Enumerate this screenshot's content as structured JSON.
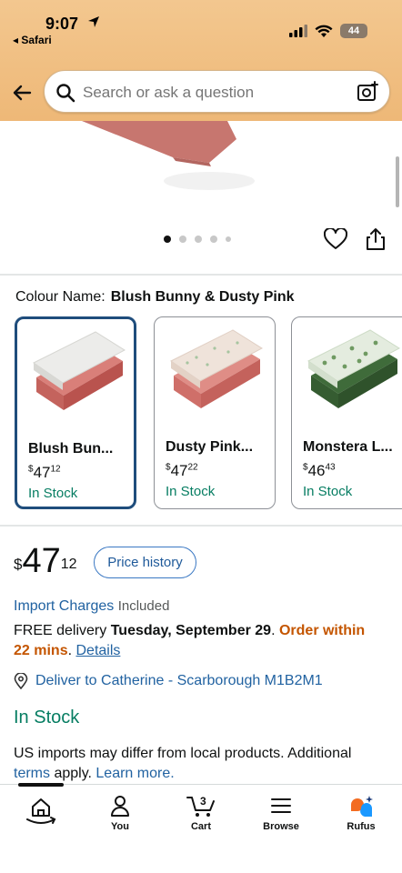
{
  "status": {
    "time": "9:07",
    "back_app": "◂ Safari",
    "battery": "44"
  },
  "search": {
    "placeholder": "Search or ask a question"
  },
  "gallery": {
    "dot_count": 5,
    "active_index": 0
  },
  "colour": {
    "label": "Colour Name:",
    "selected": "Blush Bunny & Dusty Pink",
    "options": [
      {
        "name": "Blush Bun...",
        "price_whole": "47",
        "price_fraction": "12",
        "currency": "$",
        "stock": "In Stock",
        "top_color": "#ececea",
        "base_color": "#d97f79"
      },
      {
        "name": "Dusty Pink...",
        "price_whole": "47",
        "price_fraction": "22",
        "currency": "$",
        "stock": "In Stock",
        "top_color": "#efe3da",
        "base_color": "#df8d86"
      },
      {
        "name": "Monstera L...",
        "price_whole": "46",
        "price_fraction": "43",
        "currency": "$",
        "stock": "In Stock",
        "top_color": "#e4ecdf",
        "base_color": "#3f6b3a"
      }
    ]
  },
  "price": {
    "currency": "$",
    "whole": "47",
    "fraction": "12",
    "history_button": "Price history"
  },
  "import": {
    "link": "Import Charges",
    "status": "Included"
  },
  "delivery": {
    "prefix": "FREE delivery ",
    "date": "Tuesday, September 29",
    "dot": ". ",
    "order": "Order within 22 mins",
    "period": ". ",
    "details": "Details"
  },
  "deliver_to": "Deliver to Catherine - Scarborough M1B2M1",
  "stock_status": "In Stock",
  "imports_note": {
    "text1": "US imports may differ from local products. Additional ",
    "terms": "terms",
    "text2": " apply. ",
    "learn": "Learn more."
  },
  "nav": {
    "home": "",
    "you": "You",
    "cart": "Cart",
    "cart_count": "3",
    "browse": "Browse",
    "rufus": "Rufus"
  },
  "colors": {
    "link": "#2162a1",
    "stock_green": "#067d62",
    "urgency_orange": "#c45500",
    "selected_border": "#1f4d7c",
    "header": "#f0bf83"
  }
}
